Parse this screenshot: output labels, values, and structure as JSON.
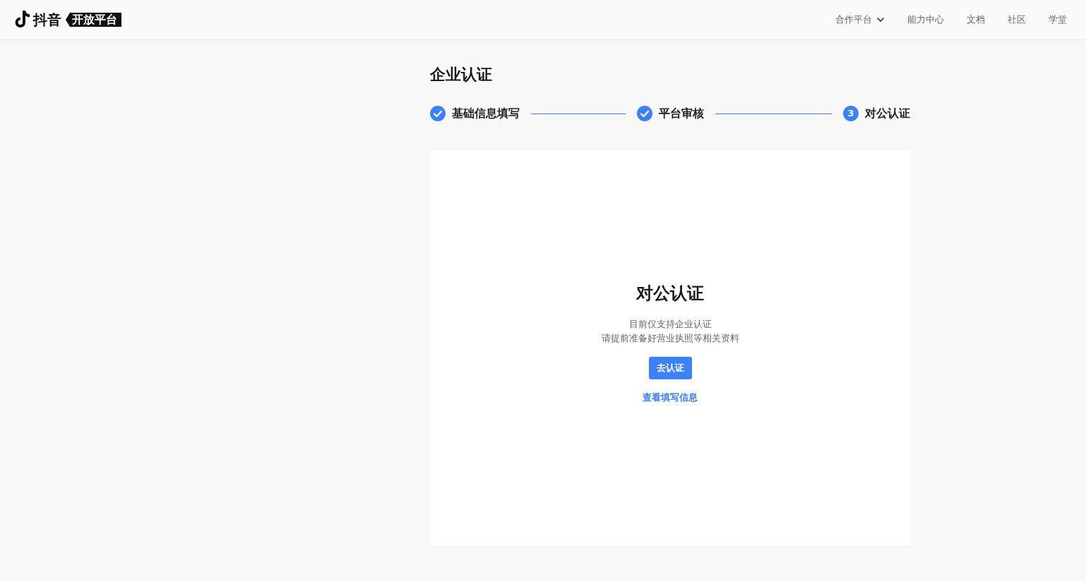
{
  "header": {
    "logo": {
      "brand": "抖音",
      "tag": "开放平台"
    },
    "nav": [
      {
        "label": "合作平台",
        "dropdown": true
      },
      {
        "label": "能力中心",
        "dropdown": false
      },
      {
        "label": "文档",
        "dropdown": false
      },
      {
        "label": "社区",
        "dropdown": false
      },
      {
        "label": "学堂",
        "dropdown": false
      }
    ]
  },
  "page_title": "企业认证",
  "steps": [
    {
      "label": "基础信息填写",
      "done": true
    },
    {
      "label": "平台审核",
      "done": true
    },
    {
      "label": "对公认证",
      "done": false,
      "number": "3"
    }
  ],
  "card": {
    "title": "对公认证",
    "description": [
      "目前仅支持企业认证",
      "请提前准备好营业执照等相关资料"
    ],
    "primary_button": "去认证",
    "link": "查看填写信息"
  }
}
